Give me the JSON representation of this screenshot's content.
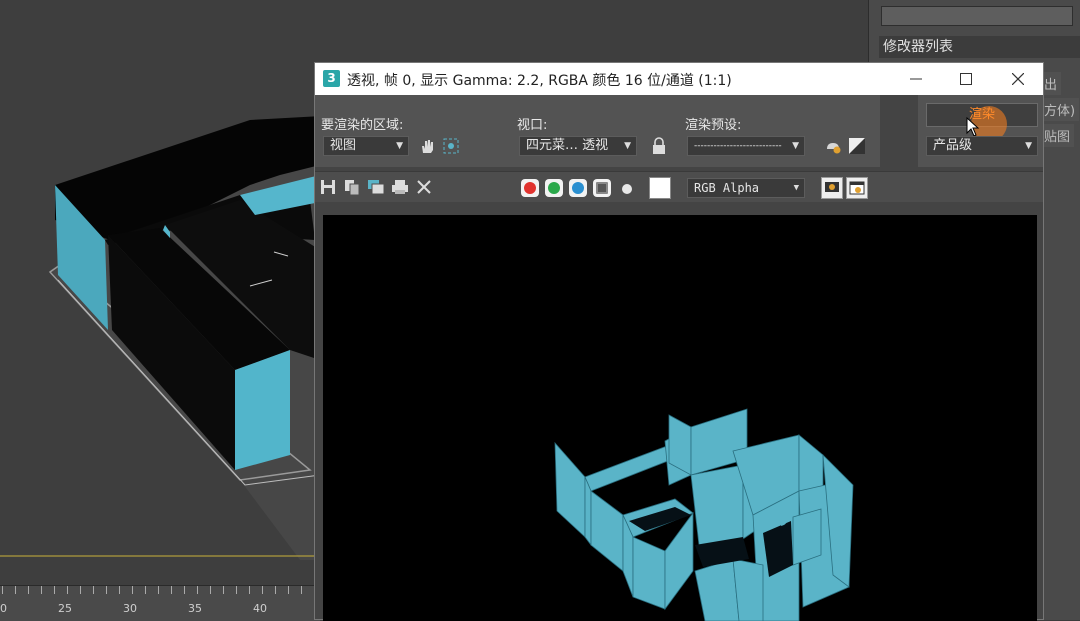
{
  "timeline": {
    "labels": [
      "0",
      "25",
      "30",
      "35",
      "40"
    ]
  },
  "command_panel": {
    "modifier_list": "修改器列表",
    "fragments": [
      "出",
      "方体)",
      "贴图"
    ]
  },
  "render_window": {
    "app_icon": "3",
    "title": "透视, 帧 0, 显示 Gamma: 2.2, RGBA 颜色 16 位/通道 (1:1)",
    "area_label": "要渲染的区域:",
    "area_value": "视图",
    "viewport_label": "视口:",
    "viewport_value": "四元菜… 透视",
    "preset_label": "渲染预设:",
    "preset_value": "---------------------------",
    "render_button": "渲染",
    "product_level": "产品级",
    "channel_value": "RGB Alpha"
  },
  "colors": {
    "accent_cyan": "#5ab4c8",
    "render_orange": "#ff8a2a",
    "channel_red": "#e0322e",
    "channel_green": "#2aa84a",
    "channel_blue": "#2a8fd0"
  }
}
